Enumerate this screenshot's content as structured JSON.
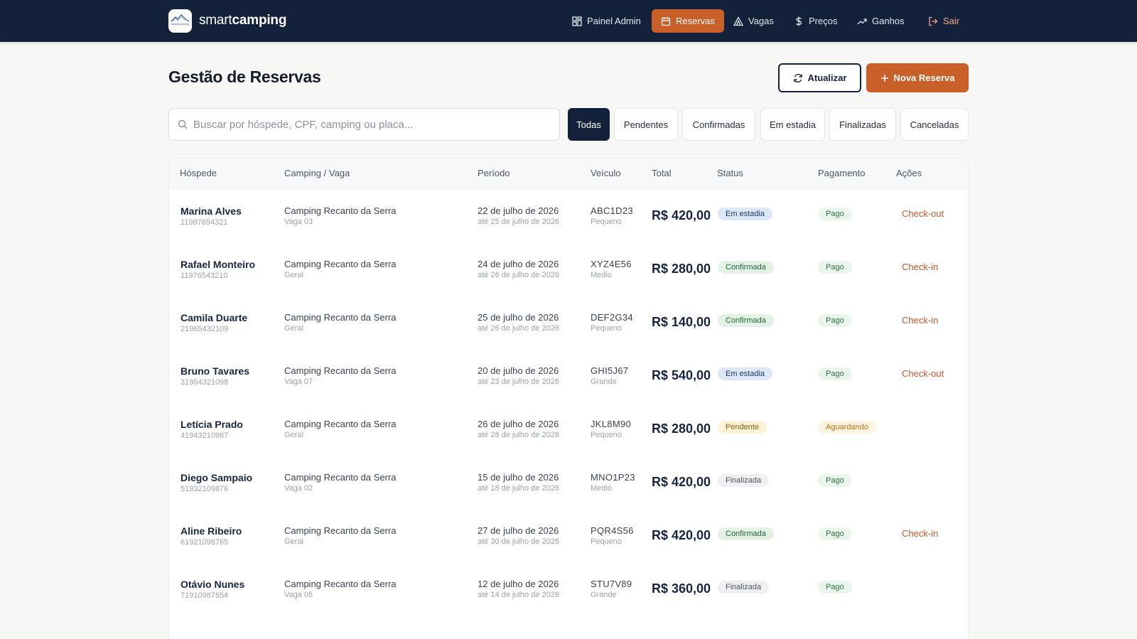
{
  "brand": {
    "light": "smart",
    "bold": "camping",
    "logo_text": "smartcamping"
  },
  "nav": [
    {
      "label": "Painel Admin",
      "icon": "dashboard-icon"
    },
    {
      "label": "Reservas",
      "icon": "calendar-icon"
    },
    {
      "label": "Vagas",
      "icon": "tent-icon"
    },
    {
      "label": "Preços",
      "icon": "dollar-icon"
    },
    {
      "label": "Ganhos",
      "icon": "trending-up-icon"
    },
    {
      "label": "Sair",
      "icon": "logout-icon"
    }
  ],
  "header": {
    "title": "Gestão de Reservas",
    "refresh_label": "Atualizar",
    "new_label": "Nova Reserva"
  },
  "search": {
    "placeholder": "Buscar por hóspede, CPF, camping ou placa...",
    "value": ""
  },
  "filters": [
    "Todas",
    "Pendentes",
    "Confirmadas",
    "Em estadia",
    "Finalizadas",
    "Canceladas"
  ],
  "active_filter": "Todas",
  "columns": [
    "Hóspede",
    "Camping / Vaga",
    "Período",
    "Veículo",
    "Total",
    "Status",
    "Pagamento",
    "Ações"
  ],
  "rows": [
    {
      "name": "Marina Alves",
      "doc": "11987654321",
      "camping": "Camping Recanto da Serra",
      "vaga": "Vaga 03",
      "start": "22 de julho de 2026",
      "end": "até 25 de julho de 2026",
      "plate": "ABC1D23",
      "size": "Pequeno",
      "total": "R$ 420,00",
      "status": "Em estadia",
      "payment": "Pago",
      "action": "Check-out"
    },
    {
      "name": "Rafael Monteiro",
      "doc": "11976543210",
      "camping": "Camping Recanto da Serra",
      "vaga": "Geral",
      "start": "24 de julho de 2026",
      "end": "até 26 de julho de 2026",
      "plate": "XYZ4E56",
      "size": "Medio",
      "total": "R$ 280,00",
      "status": "Confirmada",
      "payment": "Pago",
      "action": "Check-in"
    },
    {
      "name": "Camila Duarte",
      "doc": "21965432109",
      "camping": "Camping Recanto da Serra",
      "vaga": "Geral",
      "start": "25 de julho de 2026",
      "end": "até 26 de julho de 2026",
      "plate": "DEF2G34",
      "size": "Pequeno",
      "total": "R$ 140,00",
      "status": "Confirmada",
      "payment": "Pago",
      "action": "Check-in"
    },
    {
      "name": "Bruno Tavares",
      "doc": "31954321098",
      "camping": "Camping Recanto da Serra",
      "vaga": "Vaga 07",
      "start": "20 de julho de 2026",
      "end": "até 23 de julho de 2026",
      "plate": "GHI5J67",
      "size": "Grande",
      "total": "R$ 540,00",
      "status": "Em estadia",
      "payment": "Pago",
      "action": "Check-out"
    },
    {
      "name": "Letícia Prado",
      "doc": "41943210987",
      "camping": "Camping Recanto da Serra",
      "vaga": "Geral",
      "start": "26 de julho de 2026",
      "end": "até 28 de julho de 2026",
      "plate": "JKL8M90",
      "size": "Pequeno",
      "total": "R$ 280,00",
      "status": "Pendente",
      "payment": "Aguardando",
      "action": ""
    },
    {
      "name": "Diego Sampaio",
      "doc": "51932109876",
      "camping": "Camping Recanto da Serra",
      "vaga": "Vaga 02",
      "start": "15 de julho de 2026",
      "end": "até 18 de julho de 2026",
      "plate": "MNO1P23",
      "size": "Medio",
      "total": "R$ 420,00",
      "status": "Finalizada",
      "payment": "Pago",
      "action": ""
    },
    {
      "name": "Aline Ribeiro",
      "doc": "61921098765",
      "camping": "Camping Recanto da Serra",
      "vaga": "Geral",
      "start": "27 de julho de 2026",
      "end": "até 30 de julho de 2026",
      "plate": "PQR4S56",
      "size": "Pequeno",
      "total": "R$ 420,00",
      "status": "Confirmada",
      "payment": "Pago",
      "action": "Check-in"
    },
    {
      "name": "Otávio Nunes",
      "doc": "71910987654",
      "camping": "Camping Recanto da Serra",
      "vaga": "Vaga 05",
      "start": "12 de julho de 2026",
      "end": "até 14 de julho de 2026",
      "plate": "STU7V89",
      "size": "Grande",
      "total": "R$ 360,00",
      "status": "Finalizada",
      "payment": "Pago",
      "action": ""
    }
  ],
  "colors": {
    "navy": "#14213a",
    "accent": "#c9602a",
    "background": "#f7f7f5"
  }
}
